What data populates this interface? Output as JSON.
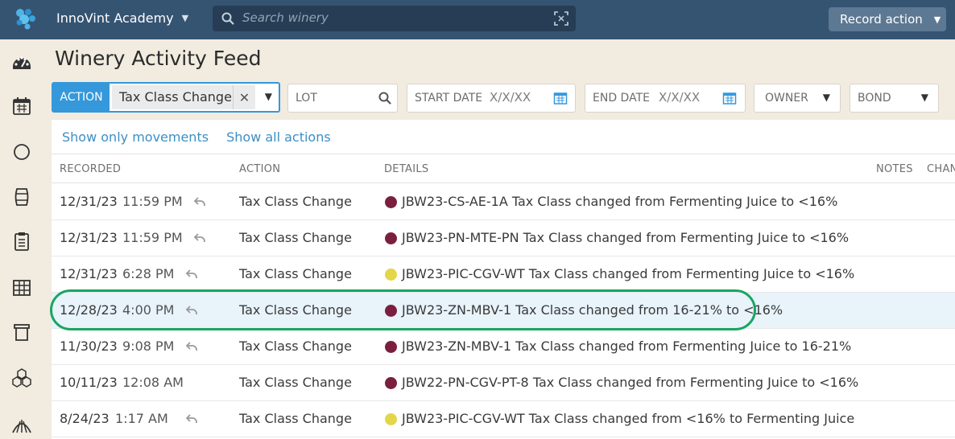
{
  "topbar": {
    "org_name": "InnoVint Academy",
    "search_placeholder": "Search winery",
    "record_label": "Record action"
  },
  "page": {
    "title": "Winery Activity Feed"
  },
  "filters": {
    "action_label": "ACTION",
    "action_value": "Tax Class Change",
    "lot_label": "LOT",
    "start_label": "START DATE",
    "start_value": "X/X/XX",
    "end_label": "END DATE",
    "end_value": "X/X/XX",
    "owner_label": "OWNER",
    "bond_label": "BOND"
  },
  "links": {
    "movements": "Show only movements",
    "all": "Show all actions"
  },
  "columns": {
    "recorded": "RECORDED",
    "action": "ACTION",
    "details": "DETAILS",
    "notes": "NOTES",
    "changed": "CHAN"
  },
  "rows": [
    {
      "date": "12/31/23",
      "time": "11:59 PM",
      "undo": true,
      "action": "Tax Class Change",
      "dot": "#7a1f3d",
      "details": "JBW23-CS-AE-1A Tax Class changed from Fermenting Juice to <16%"
    },
    {
      "date": "12/31/23",
      "time": "11:59 PM",
      "undo": true,
      "action": "Tax Class Change",
      "dot": "#7a1f3d",
      "details": "JBW23-PN-MTE-PN Tax Class changed from Fermenting Juice to <16%"
    },
    {
      "date": "12/31/23",
      "time": "6:28 PM",
      "undo": true,
      "action": "Tax Class Change",
      "dot": "#e3d64a",
      "details": "JBW23-PIC-CGV-WT Tax Class changed from Fermenting Juice to <16%"
    },
    {
      "date": "12/28/23",
      "time": "4:00 PM",
      "undo": true,
      "action": "Tax Class Change",
      "dot": "#7a1f3d",
      "details": "JBW23-ZN-MBV-1 Tax Class changed from 16-21% to <16%"
    },
    {
      "date": "11/30/23",
      "time": "9:08 PM",
      "undo": true,
      "action": "Tax Class Change",
      "dot": "#7a1f3d",
      "details": "JBW23-ZN-MBV-1 Tax Class changed from Fermenting Juice to 16-21%"
    },
    {
      "date": "10/11/23",
      "time": "12:08 AM",
      "undo": false,
      "action": "Tax Class Change",
      "dot": "#7a1f3d",
      "details": "JBW22-PN-CGV-PT-8 Tax Class changed from Fermenting Juice to <16%"
    },
    {
      "date": "8/24/23",
      "time": "1:17 AM",
      "undo": true,
      "action": "Tax Class Change",
      "dot": "#e3d64a",
      "details": "JBW23-PIC-CGV-WT Tax Class changed from <16% to Fermenting Juice"
    }
  ],
  "highlight_row": 3,
  "colors": {
    "topbar": "#355472",
    "accent": "#3498db",
    "link": "#3d8fc4",
    "highlight_ring": "#1aa561",
    "highlight_row": "#e8f3fa"
  },
  "icons": [
    "dashboard-icon",
    "calendar-icon",
    "circle-icon",
    "barrel-icon",
    "clipboard-icon",
    "grid-icon",
    "bin-icon",
    "boxes-icon",
    "vineyard-icon"
  ]
}
